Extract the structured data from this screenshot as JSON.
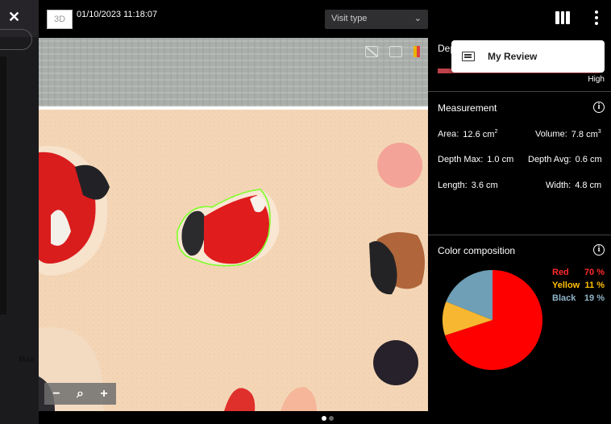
{
  "header": {
    "badge": "3D",
    "timestamp": "01/10/2023 11:18:07",
    "visit_type": {
      "label": "Visit type",
      "icon": "chevron-down-icon"
    },
    "columns_icon": "columns-icon",
    "menu_icon": "kebab-icon"
  },
  "underlay": {
    "close_icon": "close-icon",
    "max_label": "Max"
  },
  "image": {
    "overlay_icons": [
      "no-display-icon",
      "frame-icon",
      "flag-icon"
    ],
    "zoom": {
      "out": "−",
      "reset_icon": "zoom-icon",
      "in": "+"
    },
    "pager": {
      "count": 2,
      "active": 0
    }
  },
  "depth": {
    "label": "Dep",
    "level_label": "High",
    "level": 0.98,
    "color": "#c0424a"
  },
  "measurement": {
    "title": "Measurement",
    "area": {
      "label": "Area:",
      "value": "12.6 cm",
      "sup": "2"
    },
    "volume": {
      "label": "Volume:",
      "value": "7.8 cm",
      "sup": "3"
    },
    "depth_max": {
      "label": "Depth Max:",
      "value": "1.0 cm"
    },
    "depth_avg": {
      "label": "Depth Avg:",
      "value": "0.6 cm"
    },
    "length": {
      "label": "Length:",
      "value": "3.6 cm"
    },
    "width": {
      "label": "Width:",
      "value": "4.8 cm"
    }
  },
  "color_composition": {
    "title": "Color composition",
    "legend": [
      {
        "name": "Red",
        "pct": "70 %",
        "color": "#ff0000",
        "text_color": "#ff2a2a"
      },
      {
        "name": "Yellow",
        "pct": "11 %",
        "color": "#f7b731",
        "text_color": "#ffc000"
      },
      {
        "name": "Black",
        "pct": "19 %",
        "color": "#6e9fb6",
        "text_color": "#8fb4c8"
      }
    ]
  },
  "chart_data": {
    "type": "pie",
    "categories": [
      "Red",
      "Yellow",
      "Black"
    ],
    "values": [
      70,
      11,
      19
    ],
    "colors": [
      "#ff0000",
      "#f7b731",
      "#6e9fb6"
    ],
    "title": "Color composition"
  },
  "popup": {
    "label": "My Review",
    "icon": "list-icon"
  }
}
